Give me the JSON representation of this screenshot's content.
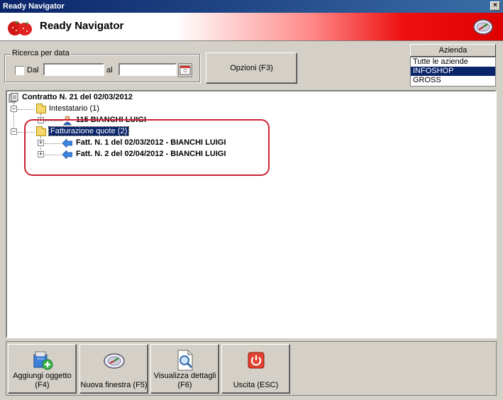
{
  "window": {
    "title": "Ready Navigator",
    "close_label": "×"
  },
  "banner": {
    "app_title": "Ready Navigator"
  },
  "date_search": {
    "group_label": "Ricerca per data",
    "from_label": "Dal",
    "to_label": "al",
    "from_value": "",
    "to_value": ""
  },
  "options_button": {
    "label": "Opzioni (F3)"
  },
  "azienda": {
    "header": "Azienda",
    "items": [
      "Tutte le aziende",
      "INFOSHOP",
      "GROSS"
    ],
    "selected": "INFOSHOP"
  },
  "tree": {
    "root": "Contratto N. 21 del 02/03/2012",
    "intestatario": "Intestatario (1)",
    "customer": "115 BIANCHI LUIGI",
    "fatturazione": "Fatturazione quote (2)",
    "invoices": [
      "Fatt. N. 1 del 02/03/2012 - BIANCHI LUIGI",
      "Fatt. N. 2 del 02/04/2012 - BIANCHI LUIGI"
    ]
  },
  "toolbar": {
    "add_line1": "Aggiungi oggetto",
    "add_line2": "(F4)",
    "new_window": "Nuova finestra (F5)",
    "details_line1": "Visualizza dettagli",
    "details_line2": "(F6)",
    "exit": "Uscita (ESC)"
  },
  "colors": {
    "selection": "#0a246a",
    "highlight_ring": "#cc2233",
    "face": "#d4d0c8"
  }
}
